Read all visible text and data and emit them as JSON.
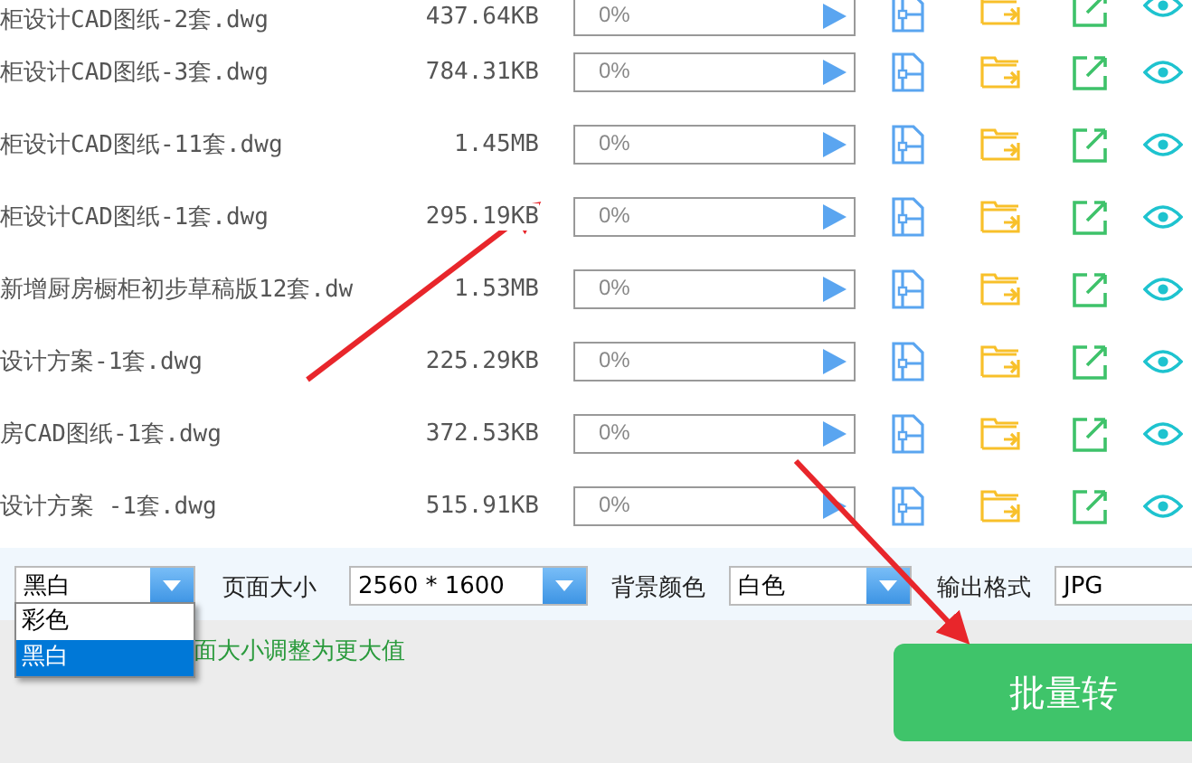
{
  "files": [
    {
      "name": "柜设计CAD图纸-2套.dwg",
      "size": "437.64KB",
      "progress": "0%",
      "level": 0
    },
    {
      "name": "柜设计CAD图纸-3套.dwg",
      "size": "784.31KB",
      "progress": "0%",
      "level": 0
    },
    {
      "name": "柜设计CAD图纸-11套.dwg",
      "size": "1.45MB",
      "progress": "0%",
      "level": 0
    },
    {
      "name": "柜设计CAD图纸-1套.dwg",
      "size": "295.19KB",
      "progress": "0%",
      "level": 0
    },
    {
      "name": "新增厨房橱柜初步草稿版12套.dw",
      "size": "1.53MB",
      "progress": "0%",
      "level": 0
    },
    {
      "name": "设计方案-1套.dwg",
      "size": "225.29KB",
      "progress": "0%",
      "level": 0
    },
    {
      "name": "房CAD图纸-1套.dwg",
      "size": "372.53KB",
      "progress": "0%",
      "level": 0
    },
    {
      "name": "设计方案 -1套.dwg",
      "size": "515.91KB",
      "progress": "0%",
      "level": 0
    }
  ],
  "settings": {
    "color_mode": {
      "value": "黑白",
      "expanded": true,
      "options": [
        {
          "label": "彩色",
          "selected": false
        },
        {
          "label": "黑白",
          "selected": true
        }
      ]
    },
    "page_size": {
      "label": "页面大小",
      "value": "2560 * 1600"
    },
    "background": {
      "label": "背景颜色",
      "value": "白色"
    },
    "output_format": {
      "label": "输出格式",
      "value": "JPG"
    }
  },
  "hint": "面大小调整为更大值",
  "convert_button": "批量转"
}
